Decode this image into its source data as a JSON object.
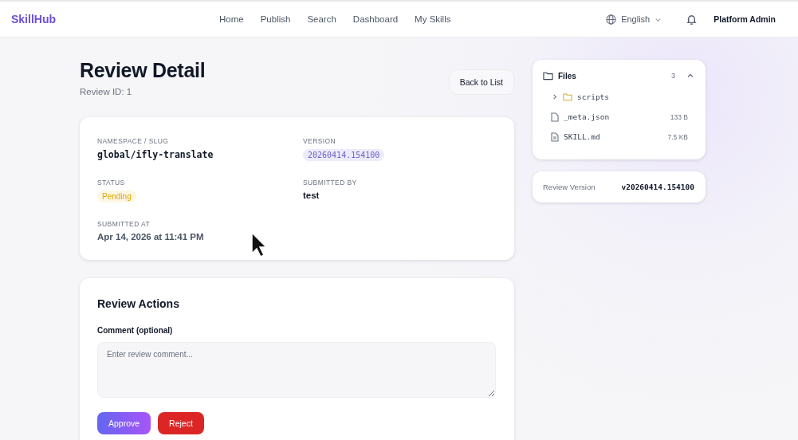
{
  "header": {
    "logo": "SkillHub",
    "nav": [
      {
        "label": "Home",
        "selected": false
      },
      {
        "label": "Publish",
        "selected": false
      },
      {
        "label": "Search",
        "selected": false
      },
      {
        "label": "Dashboard",
        "selected": false
      },
      {
        "label": "My Skills",
        "selected": false
      }
    ],
    "language": "English",
    "user": "Platform Admin"
  },
  "page": {
    "title": "Review Detail",
    "subtitle": "Review ID: 1",
    "back_button": "Back to List"
  },
  "details": [
    {
      "label": "NAMESPACE / SLUG",
      "value": "global/ifly-translate",
      "kind": "mono"
    },
    {
      "label": "VERSION",
      "value": "20260414.154100",
      "kind": "version"
    },
    {
      "label": "STATUS",
      "value": "Pending",
      "kind": "status"
    },
    {
      "label": "SUBMITTED BY",
      "value": "test",
      "kind": "text"
    },
    {
      "label": "SUBMITTED AT",
      "value": "Apr 14, 2026 at 11:41 PM",
      "kind": "date"
    }
  ],
  "actions": {
    "title": "Review Actions",
    "comment_label": "Comment (optional)",
    "placeholder": "Enter review comment...",
    "buttons": [
      {
        "label": "Approve",
        "kind": "approve"
      },
      {
        "label": "Reject",
        "kind": "reject"
      }
    ]
  },
  "files": {
    "title": "Files",
    "count": "3",
    "expanded": true,
    "items": [
      {
        "kind": "folder",
        "name": "scripts",
        "expanded": false
      },
      {
        "kind": "json",
        "name": "_meta.json",
        "size": "133 B"
      },
      {
        "kind": "doc",
        "name": "SKILL.md",
        "size": "7.5 KB"
      }
    ]
  },
  "review_version": {
    "label": "Review Version",
    "value": "v20260414.154100"
  }
}
